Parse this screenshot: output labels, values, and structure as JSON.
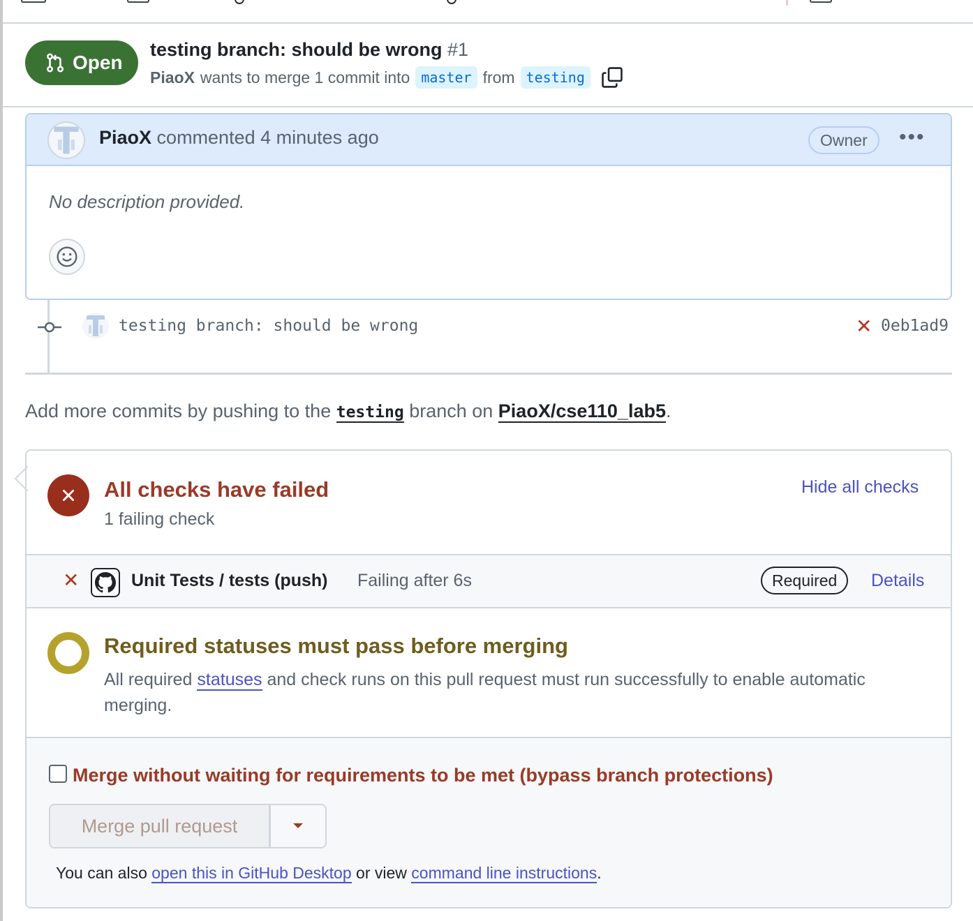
{
  "header": {
    "state": "Open",
    "title": "testing branch: should be wrong",
    "number": "#1",
    "author": "PiaoX",
    "merge_text": "wants to merge 1 commit into",
    "base_branch": "master",
    "from_text": "from",
    "head_branch": "testing"
  },
  "comment": {
    "author": "PiaoX",
    "action": "commented 4 minutes ago",
    "badge": "Owner",
    "menu": "•••",
    "body": "No description provided."
  },
  "commit": {
    "message": "testing branch: should be wrong",
    "status_icon": "✕",
    "sha": "0eb1ad9"
  },
  "add_more": {
    "prefix": "Add more commits by pushing to the",
    "branch": "testing",
    "middle": "branch on",
    "repo": "PiaoX/cse110_lab5",
    "suffix": "."
  },
  "checks": {
    "title": "All checks have failed",
    "subtitle": "1 failing check",
    "toggle_link": "Hide all checks",
    "items": [
      {
        "status_icon": "✕",
        "name": "Unit Tests / tests (push)",
        "status": "Failing after 6s",
        "badge": "Required",
        "link": "Details"
      }
    ]
  },
  "requirements": {
    "title": "Required statuses must pass before merging",
    "desc_before": "All required",
    "desc_link": "statuses",
    "desc_after": "and check runs on this pull request must run successfully to enable automatic merging."
  },
  "merge": {
    "bypass_label": "Merge without waiting for requirements to be met (bypass branch protections)",
    "bypass_checked": false,
    "button_label": "Merge pull request",
    "also_prefix": "You can also",
    "desktop_link": "open this in GitHub Desktop",
    "also_middle": "or view",
    "cli_link": "command line instructions",
    "also_suffix": "."
  },
  "colors": {
    "open_green": "#3a7234",
    "fail_red": "#9a2e1d",
    "pending_yellow": "#b5a22c",
    "link_purple": "#4b52c4"
  }
}
